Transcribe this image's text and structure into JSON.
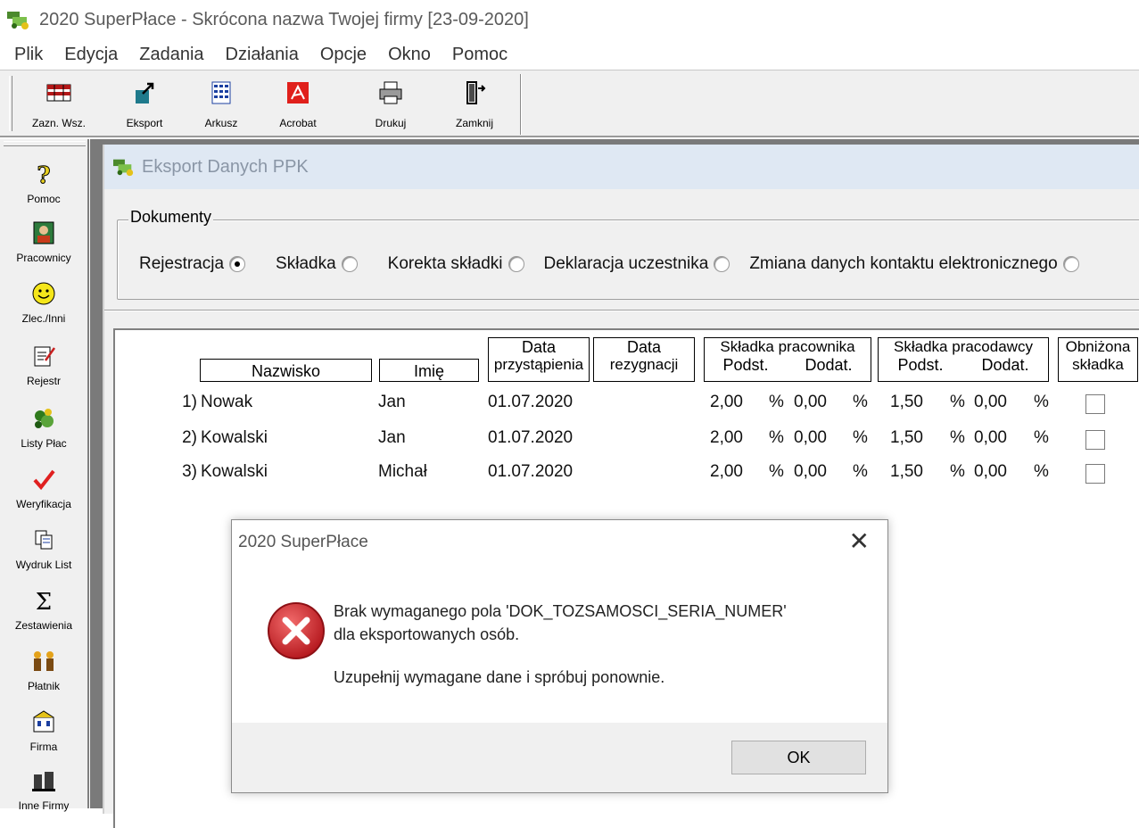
{
  "window": {
    "title": "2020 SuperPłace - Skrócona nazwa Twojej firmy [23-09-2020]"
  },
  "menu": [
    "Plik",
    "Edycja",
    "Zadania",
    "Działania",
    "Opcje",
    "Okno",
    "Pomoc"
  ],
  "toolbar": [
    {
      "label": "Zazn. Wsz.",
      "icon": "select-all-icon"
    },
    {
      "label": "Eksport",
      "icon": "export-icon"
    },
    {
      "label": "Arkusz",
      "icon": "spreadsheet-icon"
    },
    {
      "label": "Acrobat",
      "icon": "acrobat-icon"
    },
    {
      "label": "Drukuj",
      "icon": "printer-icon"
    },
    {
      "label": "Zamknij",
      "icon": "exit-door-icon"
    }
  ],
  "sidebar": [
    {
      "label": "Pomoc",
      "icon": "help-icon"
    },
    {
      "label": "Pracownicy",
      "icon": "employee-icon"
    },
    {
      "label": "Zlec./Inni",
      "icon": "smiley-icon"
    },
    {
      "label": "Rejestr",
      "icon": "register-icon"
    },
    {
      "label": "Listy Płac",
      "icon": "payroll-icon"
    },
    {
      "label": "Weryfikacja",
      "icon": "checkmark-icon"
    },
    {
      "label": "Wydruk List",
      "icon": "copy-print-icon"
    },
    {
      "label": "Zestawienia",
      "icon": "sigma-icon"
    },
    {
      "label": "Płatnik",
      "icon": "people-icon"
    },
    {
      "label": "Firma",
      "icon": "company-icon"
    },
    {
      "label": "Inne Firmy",
      "icon": "buildings-icon"
    }
  ],
  "child": {
    "title": "Eksport Danych PPK",
    "group_label": "Dokumenty",
    "radios": [
      {
        "label": "Rejestracja",
        "checked": true
      },
      {
        "label": "Składka",
        "checked": false
      },
      {
        "label": "Korekta składki",
        "checked": false
      },
      {
        "label": "Deklaracja uczestnika",
        "checked": false
      },
      {
        "label": "Zmiana danych kontaktu elektronicznego",
        "checked": false
      }
    ],
    "table": {
      "headers": {
        "nazwisko": "Nazwisko",
        "imie": "Imię",
        "data_przyst_1": "Data",
        "data_przyst_2": "przystąpienia",
        "data_rez_1": "Data",
        "data_rez_2": "rezygnacji",
        "skl_prac": "Składka pracownika",
        "skl_pracodawcy": "Składka pracodawcy",
        "podst": "Podst.",
        "dodat": "Dodat.",
        "obnizona_1": "Obniżona",
        "obnizona_2": "składka"
      },
      "percent_sign": "%",
      "rows": [
        {
          "num": "1)",
          "nazwisko": "Nowak",
          "imie": "Jan",
          "data": "01.07.2020",
          "prac_podst": "2,00",
          "prac_dodat": "0,00",
          "pracod_podst": "1,50",
          "pracod_dodat": "0,00",
          "obnizona": false
        },
        {
          "num": "2)",
          "nazwisko": "Kowalski",
          "imie": "Jan",
          "data": "01.07.2020",
          "prac_podst": "2,00",
          "prac_dodat": "0,00",
          "pracod_podst": "1,50",
          "pracod_dodat": "0,00",
          "obnizona": false
        },
        {
          "num": "3)",
          "nazwisko": "Kowalski",
          "imie": "Michał",
          "data": "01.07.2020",
          "prac_podst": "2,00",
          "prac_dodat": "0,00",
          "pracod_podst": "1,50",
          "pracod_dodat": "0,00",
          "obnizona": false
        }
      ]
    }
  },
  "dialog": {
    "title": "2020 SuperPłace",
    "close": "✕",
    "line1": "Brak wymaganego pola 'DOK_TOZSAMOSCI_SERIA_NUMER'",
    "line2": "dla eksportowanych osób.",
    "line3": "Uzupełnij wymagane dane i spróbuj ponownie.",
    "ok": "OK"
  },
  "colors": {
    "error_red": "#d9262b",
    "mdi_bg": "#7a7a7a",
    "child_title_bg": "#dfe8f3"
  }
}
